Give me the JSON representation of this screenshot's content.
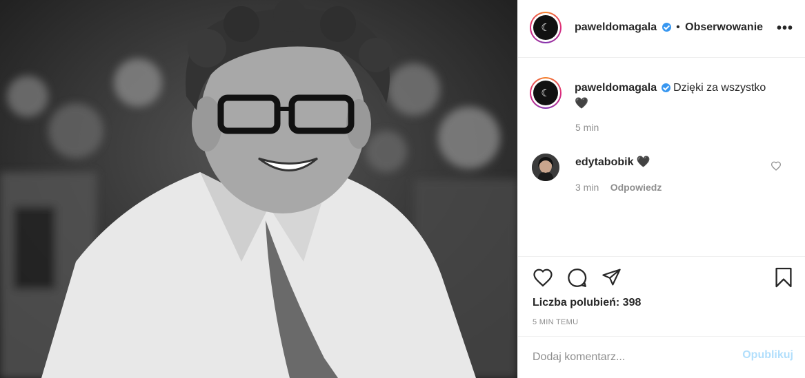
{
  "post": {
    "username": "paweldomagala",
    "follow_label": "Obserwowanie",
    "more_label": "•••",
    "avatar_glyph": "☾"
  },
  "caption": {
    "username": "paweldomagala",
    "text": "Dzięki za wszystko",
    "emoji": "🖤",
    "time": "5 min"
  },
  "comments": [
    {
      "username": "edytabobik",
      "text": "🖤",
      "time": "3 min",
      "reply_label": "Odpowiedz"
    }
  ],
  "actions": {
    "likes_label": "Liczba polubień: 398",
    "time_ago": "5 MIN TEMU"
  },
  "comment_box": {
    "placeholder": "Dodaj komentarz...",
    "publish_label": "Opublikuj"
  },
  "icons": {
    "like": "heart-icon",
    "comment": "comment-bubble-icon",
    "share": "paper-plane-icon",
    "save": "bookmark-icon",
    "comment_like": "small-heart-icon"
  },
  "colors": {
    "verified": "#3897f0",
    "publish_disabled": "#b2dffc",
    "muted": "#8e8e8e"
  }
}
